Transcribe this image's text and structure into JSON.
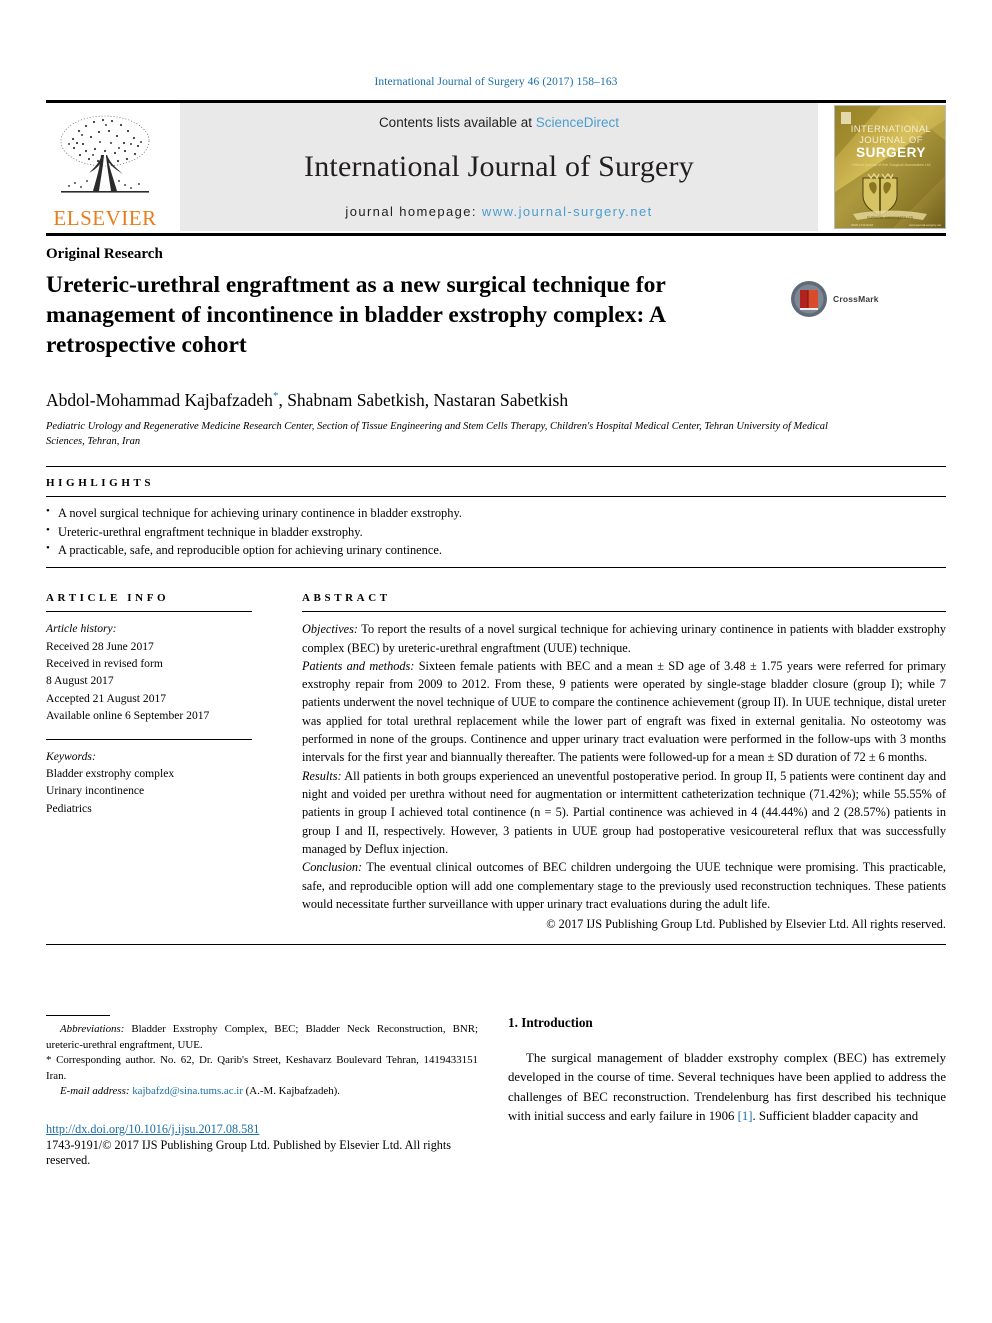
{
  "running_head": "International Journal of Surgery 46 (2017) 158–163",
  "masthead": {
    "publisher_name": "ELSEVIER",
    "contents_prefix": "Contents lists available at ",
    "contents_link": "ScienceDirect",
    "journal_title": "International Journal of Surgery",
    "homepage_prefix": "journal homepage: ",
    "homepage_url": "www.journal-surgery.net",
    "cover": {
      "line1": "INTERNATIONAL",
      "line2": "JOURNAL OF",
      "line3": "SURGERY",
      "subtitle": "Official journal of the Surgical Associates Ltd.",
      "banner_text": "SURGICAL ASSOCIATES LTD"
    }
  },
  "article": {
    "kicker": "Original Research",
    "title": "Ureteric-urethral engraftment as a new surgical technique for management of incontinence in bladder exstrophy complex: A retrospective cohort",
    "crossmark_label": "CrossMark",
    "authors_part1": "Abdol-Mohammad Kajbafzadeh",
    "author_marker": "*",
    "authors_part2": ", Shabnam Sabetkish, Nastaran Sabetkish",
    "affiliation": "Pediatric Urology and Regenerative Medicine Research Center, Section of Tissue Engineering and Stem Cells Therapy, Children's Hospital Medical Center, Tehran University of Medical Sciences, Tehran, Iran"
  },
  "highlights": {
    "heading": "HIGHLIGHTS",
    "items": [
      "A novel surgical technique for achieving urinary continence in bladder exstrophy.",
      "Ureteric-urethral engraftment technique in bladder exstrophy.",
      "A practicable, safe, and reproducible option for achieving urinary continence."
    ]
  },
  "article_info": {
    "heading": "ARTICLE INFO",
    "history_label": "Article history:",
    "history_lines": [
      "Received 28 June 2017",
      "Received in revised form",
      "8 August 2017",
      "Accepted 21 August 2017",
      "Available online 6 September 2017"
    ],
    "keywords_label": "Keywords:",
    "keywords": [
      "Bladder exstrophy complex",
      "Urinary incontinence",
      "Pediatrics"
    ]
  },
  "abstract": {
    "heading": "ABSTRACT",
    "sections": [
      {
        "label": "Objectives:",
        "text": " To report the results of a novel surgical technique for achieving urinary continence in patients with bladder exstrophy complex (BEC) by ureteric-urethral engraftment (UUE) technique."
      },
      {
        "label": "Patients and methods:",
        "text": " Sixteen female patients with BEC and a mean ± SD age of 3.48 ± 1.75 years were referred for primary exstrophy repair from 2009 to 2012. From these, 9 patients were operated by single-stage bladder closure (group I); while 7 patients underwent the novel technique of UUE to compare the continence achievement (group II). In UUE technique, distal ureter was applied for total urethral replacement while the lower part of engraft was fixed in external genitalia. No osteotomy was performed in none of the groups. Continence and upper urinary tract evaluation were performed in the follow-ups with 3 months intervals for the first year and biannually thereafter. The patients were followed-up for a mean ± SD duration of 72 ± 6 months."
      },
      {
        "label": "Results:",
        "text": " All patients in both groups experienced an uneventful postoperative period. In group II, 5 patients were continent day and night and voided per urethra without need for augmentation or intermittent catheterization technique (71.42%); while 55.55% of patients in group I achieved total continence (n = 5). Partial continence was achieved in 4 (44.44%) and 2 (28.57%) patients in group I and II, respectively. However, 3 patients in UUE group had postoperative vesicoureteral reflux that was successfully managed by Deflux injection."
      },
      {
        "label": "Conclusion:",
        "text": " The eventual clinical outcomes of BEC children undergoing the UUE technique were promising. This practicable, safe, and reproducible option will add one complementary stage to the previously used reconstruction techniques. These patients would necessitate further surveillance with upper urinary tract evaluations during the adult life."
      }
    ],
    "copyright": "© 2017 IJS Publishing Group Ltd. Published by Elsevier Ltd. All rights reserved."
  },
  "footnotes": {
    "abbreviations_label": "Abbreviations:",
    "abbreviations_text": " Bladder Exstrophy Complex, BEC; Bladder Neck Reconstruction, BNR; ureteric-urethral engraftment, UUE.",
    "corresponding_marker": "*",
    "corresponding_text": " Corresponding author. No. 62, Dr. Qarib's Street, Keshavarz Boulevard Tehran, 1419433151 Iran.",
    "email_label": "E-mail address:",
    "email": "kajbafzd@sina.tums.ac.ir",
    "email_suffix": " (A.-M. Kajbafzadeh).",
    "doi": "http://dx.doi.org/10.1016/j.ijsu.2017.08.581",
    "issn_line": "1743-9191/© 2017 IJS Publishing Group Ltd. Published by Elsevier Ltd. All rights reserved."
  },
  "introduction": {
    "heading": "1. Introduction",
    "paragraph_before_ref": "The surgical management of bladder exstrophy complex (BEC) has extremely developed in the course of time. Several techniques have been applied to address the challenges of BEC reconstruction. Trendelenburg has first described his technique with initial success and early failure in 1906 ",
    "reference": "[1]",
    "paragraph_after_ref": ". Sufficient bladder capacity and"
  },
  "colors": {
    "link_blue": "#1a6fa8",
    "sd_blue": "#4a9dd0",
    "elsevier_orange": "#E87D1E",
    "masthead_grey": "#e9e9e9"
  }
}
